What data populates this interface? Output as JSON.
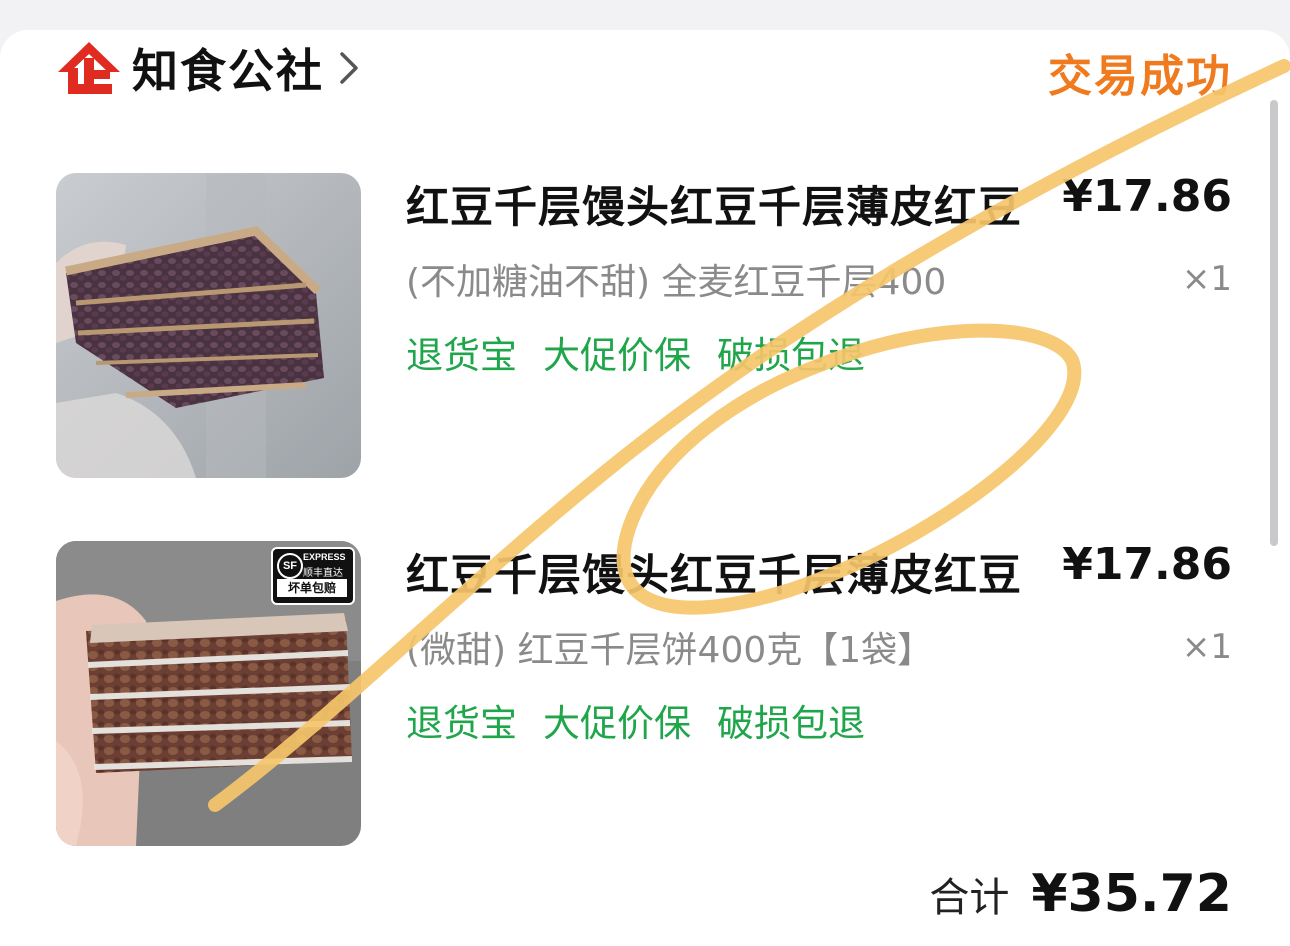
{
  "store": {
    "name": "知食公社",
    "status": "交易成功"
  },
  "products": [
    {
      "title": "红豆千层馒头红豆千层薄皮红豆",
      "spec": "(不加糖油不甜) 全麦红豆千层400",
      "price": "¥17.86",
      "qty": "×1",
      "tags": [
        "退货宝",
        "大促价保",
        "破损包退"
      ]
    },
    {
      "title": "红豆千层馒头红豆千层薄皮红豆",
      "spec": "(微甜) 红豆千层饼400克【1袋】",
      "price": "¥17.86",
      "qty": "×1",
      "tags": [
        "退货宝",
        "大促价保",
        "破损包退"
      ],
      "badge": {
        "line1": "EXPRESS",
        "line2": "顺丰直达",
        "line3": "坏单包赔",
        "logo": "SF"
      }
    }
  ],
  "summary": {
    "total_label": "合计",
    "total_value": "¥35.72"
  },
  "colors": {
    "status": "#f07a1e",
    "tag": "#1fa54a",
    "brand_logo": "#e02b20",
    "annotation": "#f5c66a"
  },
  "icons": {
    "store_logo": "store-logo-icon",
    "chevron": "chevron-right-icon"
  }
}
